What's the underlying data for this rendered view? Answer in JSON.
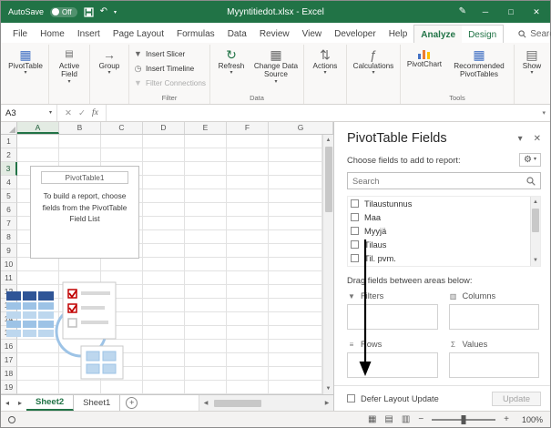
{
  "titlebar": {
    "autosave_label": "AutoSave",
    "autosave_state": "Off",
    "title": "Myyntitiedot.xlsx - Excel"
  },
  "ribbon_tabs": {
    "file": "File",
    "home": "Home",
    "insert": "Insert",
    "page_layout": "Page Layout",
    "formulas": "Formulas",
    "data": "Data",
    "review": "Review",
    "view": "View",
    "developer": "Developer",
    "help": "Help",
    "analyze": "Analyze",
    "design": "Design",
    "search": "Search"
  },
  "ribbon": {
    "pivottable": "PivotTable",
    "active_field": "Active Field",
    "group": "Group",
    "insert_slicer": "Insert Slicer",
    "insert_timeline": "Insert Timeline",
    "filter_connections": "Filter Connections",
    "filter_group_label": "Filter",
    "refresh": "Refresh",
    "change_data_source": "Change Data Source",
    "data_group_label": "Data",
    "actions": "Actions",
    "calculations": "Calculations",
    "pivotchart": "PivotChart",
    "recommended_pivottables": "Recommended PivotTables",
    "tools_group_label": "Tools",
    "show": "Show"
  },
  "formula_bar": {
    "name_box": "A3",
    "fx_label": "fx"
  },
  "grid": {
    "columns": [
      "A",
      "B",
      "C",
      "D",
      "E",
      "F",
      "G"
    ],
    "rows": [
      1,
      2,
      3,
      4,
      5,
      6,
      7,
      8,
      9,
      10,
      11,
      12,
      13,
      14,
      15,
      16,
      17,
      18,
      19
    ],
    "selected_cell": "A3",
    "placeholder_name": "PivotTable1",
    "placeholder_message": "To build a report, choose fields from the PivotTable Field List"
  },
  "sheet_bar": {
    "active_tab": "Sheet2",
    "inactive_tab": "Sheet1"
  },
  "fields_pane": {
    "title": "PivotTable Fields",
    "choose_label": "Choose fields to add to report:",
    "search_placeholder": "Search",
    "fields": [
      {
        "label": "Tilaustunnus",
        "checked": false
      },
      {
        "label": "Maa",
        "checked": false
      },
      {
        "label": "Myyjä",
        "checked": false
      },
      {
        "label": "Tilaus",
        "checked": false
      },
      {
        "label": "Til. pvm.",
        "checked": false
      }
    ],
    "drag_label": "Drag fields between areas below:",
    "areas": {
      "filters": "Filters",
      "columns": "Columns",
      "rows": "Rows",
      "values": "Values"
    },
    "defer_label": "Defer Layout Update",
    "update_label": "Update"
  },
  "status_bar": {
    "zoom_level": "100%"
  },
  "colors": {
    "excel_green": "#217346",
    "accent_blue": "#4472c4",
    "check_red": "#c00000"
  },
  "icons": {
    "undo": "↶",
    "chevron_down": "▾",
    "pencil": "✎",
    "minimize": "─",
    "maximize": "□",
    "close": "✕",
    "pivottable": "▦",
    "group_arrow": "→",
    "slicer": "▼",
    "timeline": "◷",
    "filter_connections": "▼",
    "refresh": "↻",
    "change_source": "▦",
    "actions": "⇅",
    "calculations": "ƒ",
    "recommended": "▦",
    "show": "▤",
    "cancel": "✕",
    "enter": "✓",
    "scroll_up": "▲",
    "scroll_down": "▼",
    "scroll_left": "◀",
    "scroll_right": "▶",
    "tab_nav_left": "◂",
    "tab_nav_right": "▸",
    "add_sheet": "+",
    "gear": "⚙",
    "area_filters": "▼",
    "area_columns": "▥",
    "area_rows": "≡",
    "area_values": "Σ",
    "view_normal": "▦",
    "view_layout": "▤",
    "view_break": "▥",
    "zoom_out": "−",
    "zoom_in": "+"
  }
}
